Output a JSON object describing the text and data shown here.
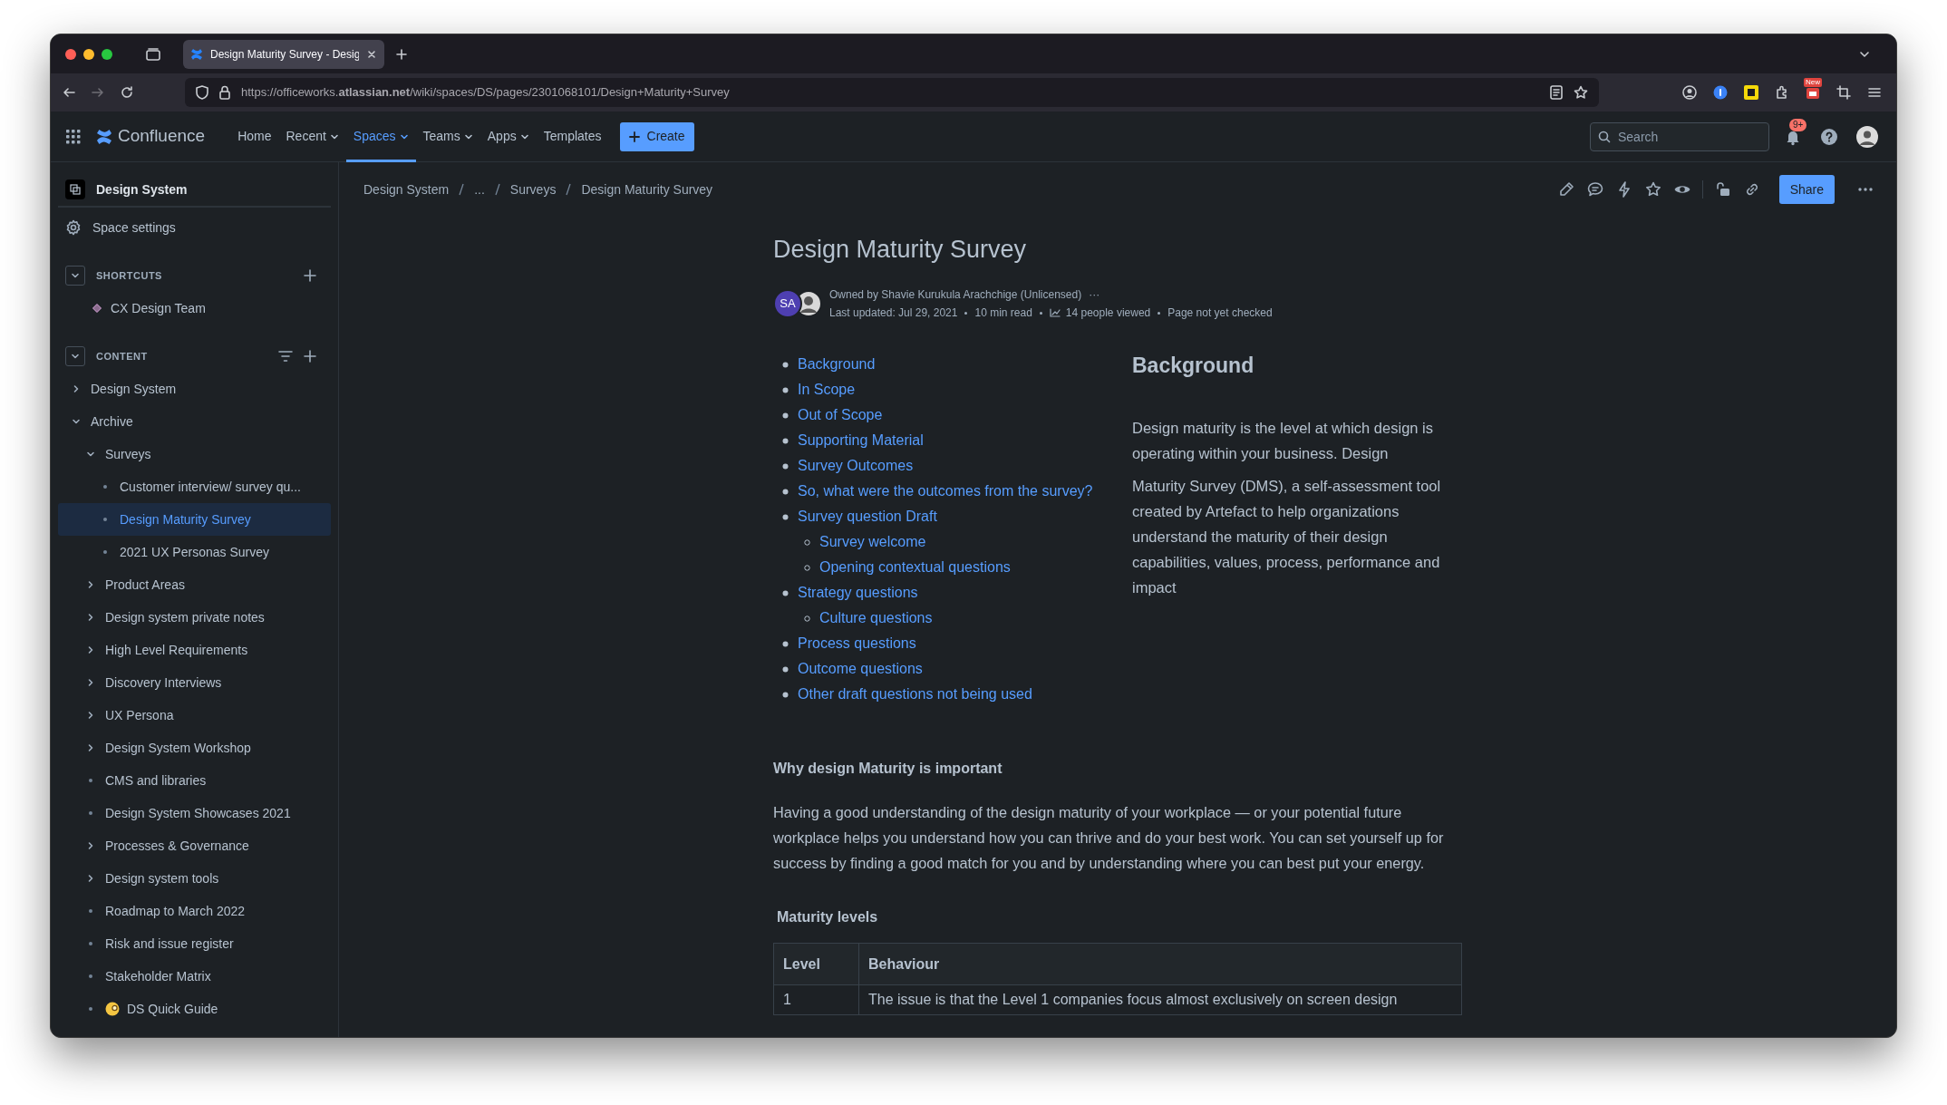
{
  "browser": {
    "tab_title": "Design Maturity Survey - Desig",
    "url": "https://officeworks.**atlassian.net**/wiki/spaces/DS/pages/2301068101/Design+Maturity+Survey",
    "extension_badge": "New"
  },
  "nav": {
    "product": "Confluence",
    "items": [
      {
        "label": "Home",
        "dropdown": false,
        "selected": false
      },
      {
        "label": "Recent",
        "dropdown": true,
        "selected": false
      },
      {
        "label": "Spaces",
        "dropdown": true,
        "selected": true
      },
      {
        "label": "Teams",
        "dropdown": true,
        "selected": false
      },
      {
        "label": "Apps",
        "dropdown": true,
        "selected": false
      },
      {
        "label": "Templates",
        "dropdown": false,
        "selected": false
      }
    ],
    "create": "Create",
    "search_placeholder": "Search",
    "notification_badge": "9+"
  },
  "sidebar": {
    "space": "Design System",
    "settings": "Space settings",
    "shortcuts_label": "SHORTCUTS",
    "shortcuts_expanded": true,
    "shortcuts": [
      "CX Design Team"
    ],
    "content_label": "CONTENT",
    "content_expanded": true,
    "tree": [
      {
        "label": "Design System",
        "kind": "branch",
        "expanded": false,
        "selected": false
      },
      {
        "label": "Archive",
        "kind": "branch",
        "expanded": true,
        "selected": false,
        "children": [
          {
            "label": "Surveys",
            "kind": "branch",
            "expanded": true,
            "selected": false,
            "children": [
              {
                "label": "Customer interview/ survey qu...",
                "kind": "leaf",
                "selected": false
              },
              {
                "label": "Design Maturity Survey",
                "kind": "leaf",
                "selected": true
              },
              {
                "label": "2021 UX Personas Survey",
                "kind": "leaf",
                "selected": false
              }
            ]
          },
          {
            "label": "Product Areas",
            "kind": "branch",
            "expanded": false,
            "selected": false
          },
          {
            "label": "Design system private notes",
            "kind": "branch",
            "expanded": false,
            "selected": false
          },
          {
            "label": "High Level Requirements",
            "kind": "branch",
            "expanded": false,
            "selected": false
          },
          {
            "label": "Discovery Interviews",
            "kind": "branch",
            "expanded": false,
            "selected": false
          },
          {
            "label": "UX Persona",
            "kind": "branch",
            "expanded": false,
            "selected": false
          },
          {
            "label": "Design System Workshop",
            "kind": "branch",
            "expanded": false,
            "selected": false
          },
          {
            "label": "CMS and libraries",
            "kind": "leaf",
            "selected": false
          },
          {
            "label": "Design System Showcases 2021",
            "kind": "leaf",
            "selected": false
          },
          {
            "label": "Processes & Governance",
            "kind": "branch",
            "expanded": false,
            "selected": false
          },
          {
            "label": "Design system tools",
            "kind": "branch",
            "expanded": false,
            "selected": false
          },
          {
            "label": "Roadmap to March 2022",
            "kind": "leaf",
            "selected": false
          },
          {
            "label": "Risk and issue register",
            "kind": "leaf",
            "selected": false
          },
          {
            "label": "Stakeholder Matrix",
            "kind": "leaf",
            "selected": false
          },
          {
            "label": "DS Quick Guide",
            "kind": "emoji",
            "selected": false
          }
        ]
      }
    ]
  },
  "breadcrumbs": [
    "Design System",
    "...",
    "Surveys",
    "Design Maturity Survey"
  ],
  "share": "Share",
  "page": {
    "title": "Design Maturity Survey",
    "avatar_initials": "SA",
    "owner": "Owned by Shavie Kurukula Arachchige (Unlicensed)",
    "more": "···",
    "meta": [
      {
        "text": "Last updated: Jul 29, 2021",
        "kind": "plain"
      },
      {
        "text": "10 min read",
        "kind": "plain"
      },
      {
        "text": "14 people viewed",
        "kind": "views"
      },
      {
        "text": "Page not yet checked",
        "kind": "plain"
      }
    ],
    "toc": [
      {
        "label": "Background"
      },
      {
        "label": "In Scope"
      },
      {
        "label": "Out of Scope"
      },
      {
        "label": "Supporting Material"
      },
      {
        "label": "Survey Outcomes"
      },
      {
        "label": "So, what were the outcomes from the survey?"
      },
      {
        "label": "Survey question Draft",
        "children": [
          {
            "label": "Survey welcome"
          },
          {
            "label": "Opening contextual questions"
          }
        ]
      },
      {
        "label": "Strategy questions",
        "children": [
          {
            "label": "Culture questions"
          }
        ]
      },
      {
        "label": "Process questions"
      },
      {
        "label": "Outcome questions"
      },
      {
        "label": "Other draft questions not being used"
      }
    ],
    "background_heading": "Background",
    "background_paragraphs": [
      "Design maturity is the level at which design is operating within your business. Design",
      "Maturity Survey (DMS), a self-assessment tool created by Artefact to help organizations understand the maturity of their design capabilities, values, process, performance and impact"
    ],
    "why_heading": "Why design Maturity is important",
    "why_paragraph": "Having a good understanding of the design maturity of your workplace — or your potential future workplace  helps you understand how you can thrive and do your best work. You can set yourself up for success by finding a good match for you and by understanding where you can best put your energy.",
    "levels_heading": "Maturity levels",
    "table": {
      "columns": [
        "Level",
        "Behaviour"
      ],
      "rows": [
        [
          "1",
          "The issue is that the Level 1 companies focus almost exclusively on screen design"
        ]
      ]
    }
  }
}
